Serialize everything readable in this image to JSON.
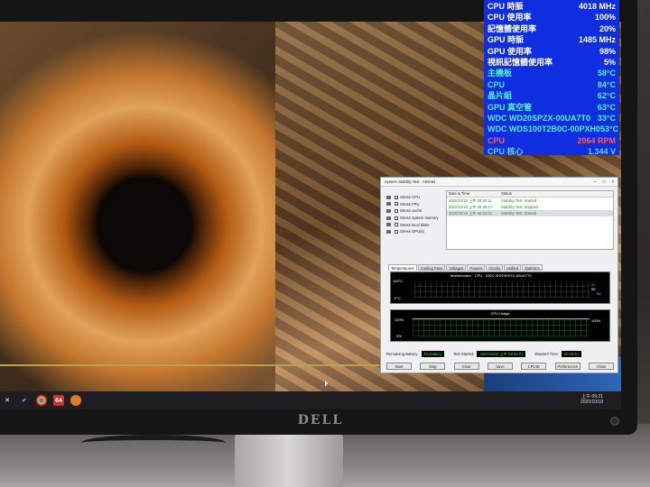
{
  "osd": {
    "rows": [
      {
        "label": "CPU 時脈",
        "value": "4018 MHz",
        "color": "#ffffff"
      },
      {
        "label": "CPU 使用率",
        "value": "100%",
        "color": "#ffffff"
      },
      {
        "label": "記憶體使用率",
        "value": "20%",
        "color": "#ffffff"
      },
      {
        "label": "GPU 時脈",
        "value": "1485 MHz",
        "color": "#ffffff"
      },
      {
        "label": "GPU 使用率",
        "value": "98%",
        "color": "#ffffff"
      },
      {
        "label": "視訊記憶體使用率",
        "value": "5%",
        "color": "#ffffff"
      },
      {
        "label": "主機板",
        "value": "58°C",
        "color": "#4ef0f0"
      },
      {
        "label": "CPU",
        "value": "84°C",
        "color": "#4ef0f0"
      },
      {
        "label": "晶片組",
        "value": "62°C",
        "color": "#4ef0f0"
      },
      {
        "label": "GPU 真空管",
        "value": "63°C",
        "color": "#4ef0f0"
      },
      {
        "label": "WDC WD20SPZX-00UA7T0",
        "value": "33°C",
        "color": "#4ef0f0"
      },
      {
        "label": "WDC WDS100T2B0C-00PXH0",
        "value": "53°C",
        "color": "#4ef0f0"
      },
      {
        "label": "CPU",
        "value": "2064 RPM",
        "color": "#ff5b5b"
      },
      {
        "label": "CPU 核心",
        "value": "1.344 V",
        "color": "#6fd0ff"
      }
    ]
  },
  "window": {
    "title": "System Stability Test - AIDA64",
    "stress_options": [
      {
        "label": "Stress CPU",
        "checked": true
      },
      {
        "label": "Stress FPU",
        "checked": true
      },
      {
        "label": "Stress cache",
        "checked": false
      },
      {
        "label": "Stress system memory",
        "checked": false
      },
      {
        "label": "Stress local disks",
        "checked": false
      },
      {
        "label": "Stress GPU(s)",
        "checked": false
      }
    ],
    "log_headers": {
      "date": "Date & Time",
      "status": "Status"
    },
    "log_rows": [
      {
        "date": "2020/10/18 上午 08:26:11",
        "status": "Stability Test: Started"
      },
      {
        "date": "2020/10/18 上午 08:48:27",
        "status": "Stability Test: Stopped"
      },
      {
        "date": "2020/10/18 上午 08:53:01",
        "status": "Stability Test: Started"
      }
    ],
    "tabs": [
      "Temperatures",
      "Cooling Fans",
      "Voltages",
      "Powers",
      "Clocks",
      "Unified",
      "Statistics"
    ],
    "temp_graph": {
      "legend": [
        "Motherboard",
        "CPU",
        "WDC WD20SPZX-00UA7T0"
      ],
      "y_max": "100°C",
      "y_min": "0°C",
      "right_values": [
        "84",
        "58",
        "33"
      ]
    },
    "usage_graph": {
      "title": "CPU Usage",
      "y_max": "100%",
      "y_min": "0%",
      "right_value": "100%"
    },
    "status": {
      "battery_label": "Remaining Battery:",
      "battery_value": "No battery",
      "started_label": "Test Started:",
      "started_value": "2020/10/18 上午 08:53:01",
      "elapsed_label": "Elapsed Time:",
      "elapsed_value": "00:28:51"
    },
    "buttons": [
      "Start",
      "Stop",
      "Clear",
      "Save",
      "CPUID",
      "Preferences",
      "Close"
    ]
  },
  "taskbar": {
    "time": "上午 09:21",
    "date": "2020/10/18"
  },
  "monitor": {
    "brand": "DELL"
  }
}
